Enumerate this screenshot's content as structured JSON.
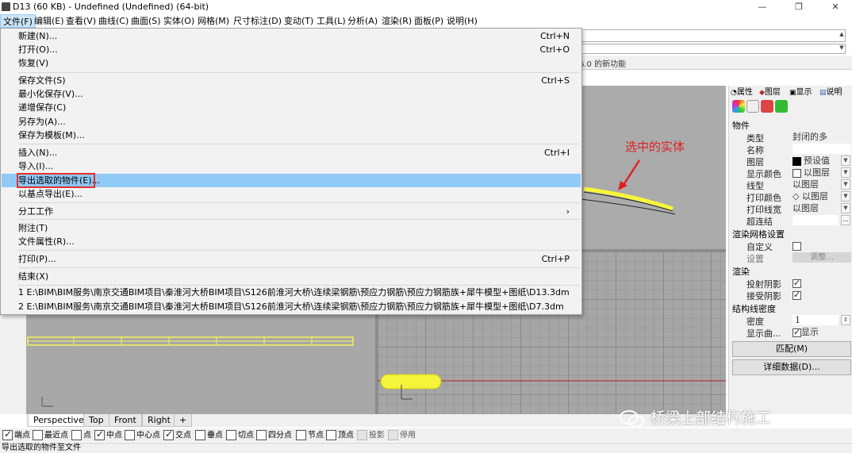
{
  "window": {
    "title": "D13 (60 KB) - Undefined (Undefined) (64-bit)",
    "buttons": [
      "—",
      "❐",
      "✕"
    ]
  },
  "menubar": [
    "文件(F)",
    "编辑(E)",
    "查看(V)",
    "曲线(C)",
    "曲面(S)",
    "实体(O)",
    "网格(M)",
    "尺寸标注(D)",
    "变动(T)",
    "工具(L)",
    "分析(A)",
    "渲染(R)",
    "面板(P)",
    "说明(H)"
  ],
  "tabstrip": {
    "text": "6.0 的新功能"
  },
  "file_menu": {
    "items": [
      {
        "label": "新建(N)...",
        "shortcut": "Ctrl+N"
      },
      {
        "label": "打开(O)...",
        "shortcut": "Ctrl+O"
      },
      {
        "label": "恢复(V)",
        "shortcut": ""
      },
      {
        "label": "保存文件(S)",
        "shortcut": "Ctrl+S"
      },
      {
        "label": "最小化保存(V)...",
        "shortcut": ""
      },
      {
        "label": "递增保存(C)",
        "shortcut": ""
      },
      {
        "label": "另存为(A)...",
        "shortcut": ""
      },
      {
        "label": "保存为模板(M)...",
        "shortcut": ""
      },
      {
        "label": "插入(N)...",
        "shortcut": "Ctrl+I"
      },
      {
        "label": "导入(I)...",
        "shortcut": ""
      },
      {
        "label": "导出选取的物件(E)...",
        "shortcut": ""
      },
      {
        "label": "以基点导出(E)...",
        "shortcut": ""
      },
      {
        "label": "分工工作",
        "shortcut": "›"
      },
      {
        "label": "附注(T)",
        "shortcut": ""
      },
      {
        "label": "文件属性(R)...",
        "shortcut": ""
      },
      {
        "label": "打印(P)...",
        "shortcut": "Ctrl+P"
      },
      {
        "label": "结束(X)",
        "shortcut": ""
      },
      {
        "label": "1 E:\\BIM\\BIM服务\\南京交通BIM项目\\秦淮河大桥BIM项目\\S126前淮河大桥\\连续梁钢筋\\预应力钢筋\\预应力钢筋族+犀牛模型+图纸\\D13.3dm",
        "shortcut": ""
      },
      {
        "label": "2 E:\\BIM\\BIM服务\\南京交通BIM项目\\秦淮河大桥BIM项目\\S126前淮河大桥\\连续梁钢筋\\预应力钢筋\\预应力钢筋族+犀牛模型+图纸\\D7.3dm",
        "shortcut": ""
      }
    ]
  },
  "annotation": {
    "text": "选中的实体",
    "color": "#e02020"
  },
  "properties_panel": {
    "tabs": [
      "属性",
      "图层",
      "显示",
      "说明"
    ],
    "section_object": "物件",
    "rows": [
      {
        "label": "类型",
        "value": "封闭的多"
      },
      {
        "label": "名称",
        "value": ""
      },
      {
        "label": "图层",
        "value": "预设值"
      },
      {
        "label": "显示颜色",
        "value": "以图层"
      },
      {
        "label": "线型",
        "value": "以图层"
      },
      {
        "label": "打印颜色",
        "value": "◇ 以图层"
      },
      {
        "label": "打印线宽",
        "value": "以图层"
      },
      {
        "label": "超连结",
        "value": ""
      }
    ],
    "section_mesh": "渲染网格设置",
    "mesh_rows": [
      {
        "label": "自定义",
        "value": ""
      },
      {
        "label": "设置",
        "value": "调整..."
      }
    ],
    "section_render": "渲染",
    "render_rows": [
      {
        "label": "投射阴影"
      },
      {
        "label": "接受阴影"
      }
    ],
    "section_isocurve": "结构线密度",
    "iso_rows": [
      {
        "label": "密度",
        "value": "1"
      },
      {
        "label": "显示曲...",
        "value": "显示"
      }
    ],
    "match_button": "匹配(M)",
    "details_button": "详细数据(D)..."
  },
  "viewport_tabs": [
    "Perspective",
    "Top",
    "Front",
    "Right",
    "+"
  ],
  "osnap": [
    {
      "label": "端点",
      "checked": true
    },
    {
      "label": "最近点",
      "checked": false
    },
    {
      "label": "点",
      "checked": false
    },
    {
      "label": "中点",
      "checked": true
    },
    {
      "label": "中心点",
      "checked": false
    },
    {
      "label": "交点",
      "checked": true
    },
    {
      "label": "垂点",
      "checked": false
    },
    {
      "label": "切点",
      "checked": false
    },
    {
      "label": "四分点",
      "checked": false
    },
    {
      "label": "节点",
      "checked": false
    },
    {
      "label": "顶点",
      "checked": false
    },
    {
      "label": "投影",
      "checked": false
    },
    {
      "label": "停用",
      "checked": false
    }
  ],
  "statusbar": {
    "text": "导出选取的物件至文件"
  },
  "watermark": {
    "text": "桥梁上部结构施工"
  }
}
